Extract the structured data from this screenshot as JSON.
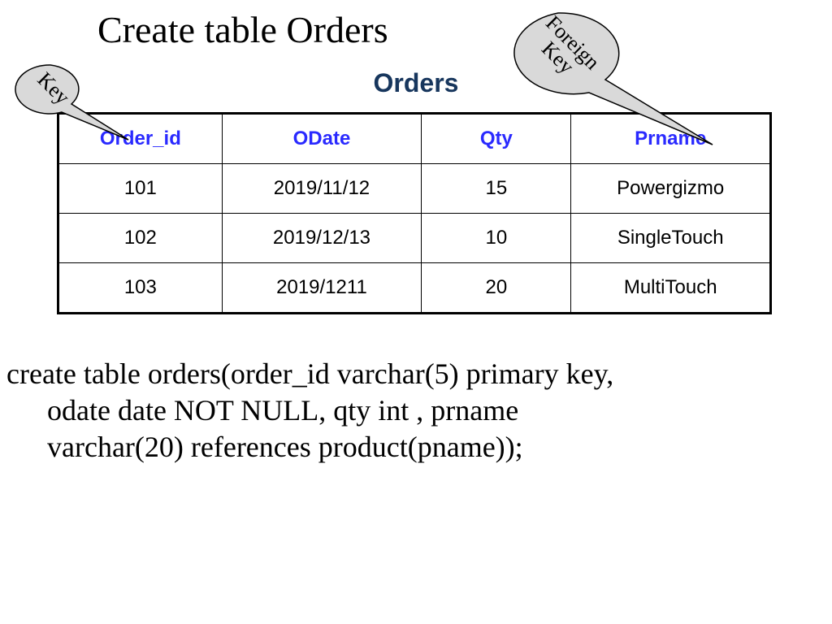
{
  "slide": {
    "title": "Create table Orders",
    "table_title": "Orders"
  },
  "table": {
    "headers": [
      "Order_id",
      "ODate",
      "Qty",
      "Prname"
    ],
    "rows": [
      {
        "id": "101",
        "date": "2019/11/12",
        "qty": "15",
        "name": "Powergizmo"
      },
      {
        "id": "102",
        "date": "2019/12/13",
        "qty": "10",
        "name": "SingleTouch"
      },
      {
        "id": "103",
        "date": "2019/1211",
        "qty": "20",
        "name": "MultiTouch"
      }
    ]
  },
  "sql": {
    "line1": "create table orders(order_id varchar(5) primary key,",
    "line2": "odate date NOT NULL, qty int , prname",
    "line3": "varchar(20) references product(pname));"
  },
  "callouts": {
    "key": "Key",
    "foreign_key": "Foreign\nKey"
  }
}
